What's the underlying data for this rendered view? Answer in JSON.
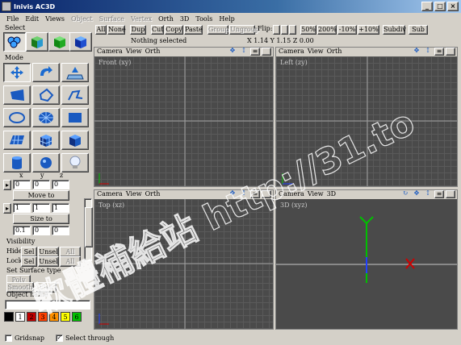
{
  "window": {
    "title": "Inivis AC3D",
    "min": "_",
    "max": "□",
    "close": "×"
  },
  "menu": [
    {
      "label": "File",
      "enabled": true
    },
    {
      "label": "Edit",
      "enabled": true
    },
    {
      "label": "Views",
      "enabled": true
    },
    {
      "label": "Object",
      "enabled": false
    },
    {
      "label": "Surface",
      "enabled": false
    },
    {
      "label": "Vertex",
      "enabled": false
    },
    {
      "label": "Orth",
      "enabled": true
    },
    {
      "label": "3D",
      "enabled": true
    },
    {
      "label": "Tools",
      "enabled": true
    },
    {
      "label": "Help",
      "enabled": true
    }
  ],
  "left": {
    "select_label": "Select",
    "mode_label": "Mode",
    "axis_x": "x",
    "axis_y": "y",
    "axis_z": "z",
    "move_row": [
      "0",
      "0",
      "0"
    ],
    "move_to": "Move to",
    "size_row": [
      "1",
      "1",
      "1"
    ],
    "size_to": "Size to",
    "last_row": [
      "0.1",
      "0",
      "0"
    ],
    "visibility_label": "Visibility",
    "hide_label": "Hide:",
    "lock_label": "Lock:",
    "sel": "Sel",
    "unsel": "Unsel",
    "all": "All",
    "surface_type_label": "Set Surface type",
    "poly": "Poly",
    "smooth": "Smooth",
    "flat": "Flat",
    "object_name_label": "Object name",
    "palette": [
      {
        "label": "1",
        "color": "#ffffff"
      },
      {
        "label": "2",
        "color": "#c00000"
      },
      {
        "label": "3",
        "color": "#ff4000"
      },
      {
        "label": "4",
        "color": "#ff9000"
      },
      {
        "label": "5",
        "color": "#ffff00"
      },
      {
        "label": "6",
        "color": "#00c000"
      }
    ]
  },
  "toolbar": {
    "all": "All",
    "none": "None",
    "dup": "Dup",
    "cut": "Cut",
    "copy": "Copy",
    "paste": "Paste",
    "group": "Group",
    "ungroup": "Ungroup",
    "flip": "Flip:",
    "zoom50": "50%",
    "zoom200": "200%",
    "zoom_minus10": "-10%",
    "zoom_plus10": "+10%",
    "subdiv": "Subdiv",
    "sub": "Sub"
  },
  "status": {
    "selection": "Nothing selected",
    "coords": "X 1.14 Y 1.15 Z 0.00"
  },
  "viewports": [
    {
      "header": [
        "Camera",
        "View",
        "Orth"
      ],
      "name": "Front (xy)"
    },
    {
      "header": [
        "Camera",
        "View",
        "Orth"
      ],
      "name": "Left (zy)"
    },
    {
      "header": [
        "Camera",
        "View",
        "Orth"
      ],
      "name": "Top (xz)"
    },
    {
      "header": [
        "Camera",
        "View",
        "3D"
      ],
      "name": "3D (xyz)"
    }
  ],
  "bottom": {
    "gridsnap": "Gridsnap",
    "select_through": "Select through",
    "select_through_checked": "✓"
  },
  "watermark": "軟體補給站 http://31.to"
}
